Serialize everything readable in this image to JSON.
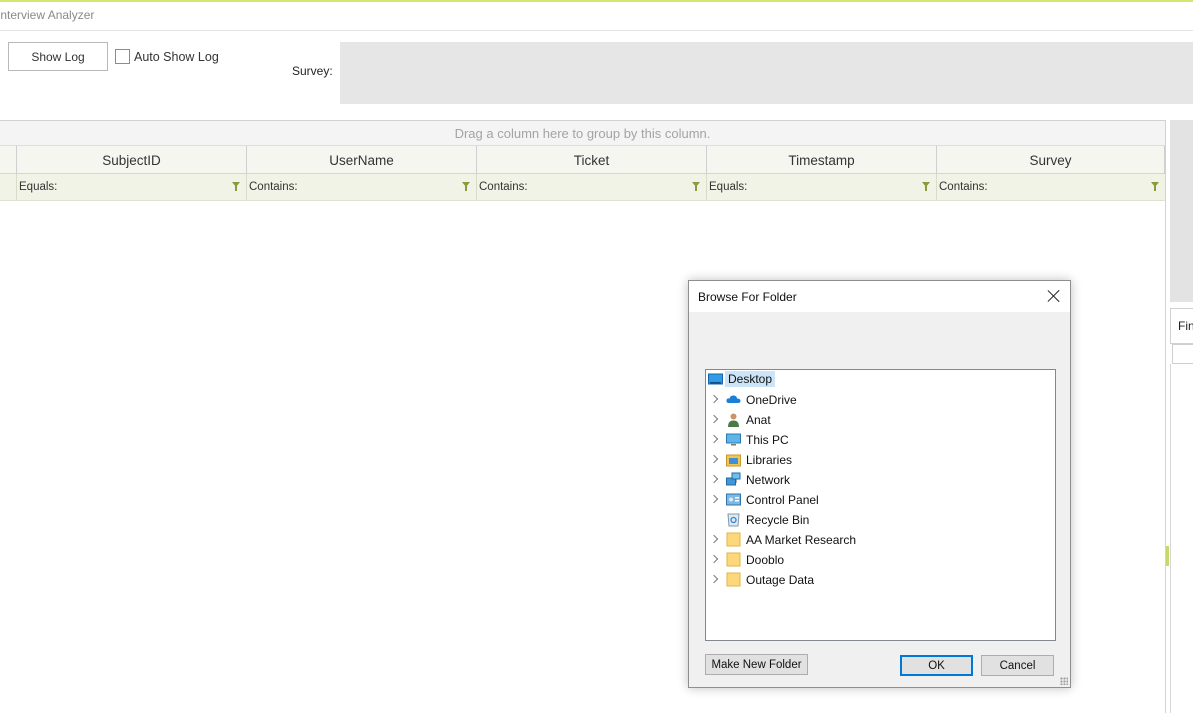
{
  "app": {
    "title": "Interview Analyzer"
  },
  "toolbar": {
    "show_log_label": "Show Log",
    "auto_show_log_label": "Auto Show Log",
    "survey_label": "Survey:"
  },
  "grid": {
    "group_panel_text": "Drag a column here to group by this column.",
    "columns": [
      {
        "header": "SubjectID",
        "filter": "Equals:"
      },
      {
        "header": "UserName",
        "filter": "Contains:"
      },
      {
        "header": "Ticket",
        "filter": "Contains:"
      },
      {
        "header": "Timestamp",
        "filter": "Equals:"
      },
      {
        "header": "Survey",
        "filter": "Contains:"
      }
    ]
  },
  "right_panel": {
    "tab_label": "Fin"
  },
  "dialog": {
    "title": "Browse For Folder",
    "tree": [
      {
        "label": "Desktop",
        "icon": "desktop-icon",
        "root": true
      },
      {
        "label": "OneDrive",
        "icon": "cloud-icon",
        "expandable": true
      },
      {
        "label": "Anat",
        "icon": "user-icon",
        "expandable": true
      },
      {
        "label": "This PC",
        "icon": "computer-icon",
        "expandable": true
      },
      {
        "label": "Libraries",
        "icon": "library-icon",
        "expandable": true
      },
      {
        "label": "Network",
        "icon": "network-icon",
        "expandable": true
      },
      {
        "label": "Control Panel",
        "icon": "control-panel-icon",
        "expandable": true
      },
      {
        "label": "Recycle Bin",
        "icon": "recycle-bin-icon",
        "expandable": false
      },
      {
        "label": "AA Market Research",
        "icon": "folder-icon",
        "expandable": true
      },
      {
        "label": "Dooblo",
        "icon": "folder-icon",
        "expandable": true
      },
      {
        "label": "Outage Data",
        "icon": "folder-icon",
        "expandable": true
      }
    ],
    "buttons": {
      "make_new_folder": "Make New Folder",
      "ok": "OK",
      "cancel": "Cancel"
    }
  }
}
